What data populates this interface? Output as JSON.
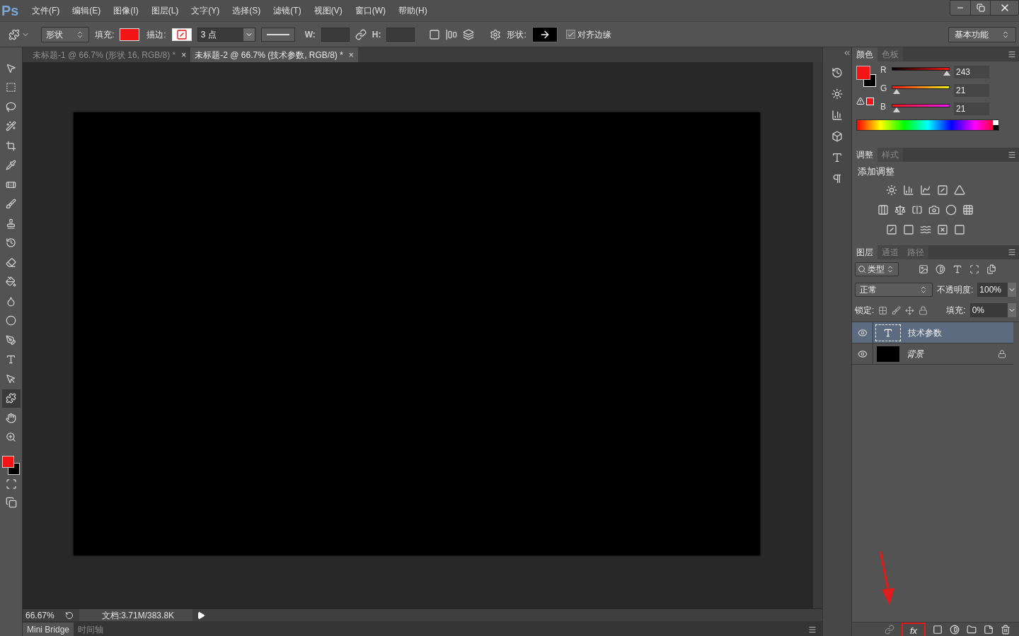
{
  "app_logo": "Ps",
  "menu": [
    "文件(F)",
    "编辑(E)",
    "图像(I)",
    "图层(L)",
    "文字(Y)",
    "选择(S)",
    "滤镜(T)",
    "视图(V)",
    "窗口(W)",
    "帮助(H)"
  ],
  "options_bar": {
    "mode": "形状",
    "fill_label": "填充:",
    "stroke_label": "描边:",
    "stroke_width": "3 点",
    "w_label": "W:",
    "h_label": "H:",
    "shape_label": "形状:",
    "align_edges": {
      "label": "对齐边缘",
      "checked": true
    },
    "workspace": "基本功能"
  },
  "doc_tabs": [
    {
      "title": "未标题-1 @ 66.7% (形状 16, RGB/8) *",
      "close": "×",
      "selected": false
    },
    {
      "title": "未标题-2 @ 66.7% (技术参数, RGB/8) *",
      "close": "×",
      "selected": true
    }
  ],
  "tools": [
    {
      "kind": "move",
      "selected": false
    },
    {
      "kind": "marquee",
      "selected": false
    },
    {
      "kind": "lasso",
      "selected": false
    },
    {
      "kind": "quick_select",
      "selected": false
    },
    {
      "kind": "crop",
      "selected": false
    },
    {
      "kind": "eyedropper",
      "selected": false
    },
    {
      "kind": "healing",
      "selected": false
    },
    {
      "kind": "brush",
      "selected": false
    },
    {
      "kind": "stamp",
      "selected": false
    },
    {
      "kind": "history_brush",
      "selected": false
    },
    {
      "kind": "eraser",
      "selected": false
    },
    {
      "kind": "bucket",
      "selected": false
    },
    {
      "kind": "blur",
      "selected": false
    },
    {
      "kind": "dodge",
      "selected": false
    },
    {
      "kind": "pen",
      "selected": false
    },
    {
      "kind": "type",
      "selected": false
    },
    {
      "kind": "path_select",
      "selected": false
    },
    {
      "kind": "custom_shape",
      "selected": true
    },
    {
      "kind": "hand",
      "selected": false
    },
    {
      "kind": "zoom",
      "selected": false
    }
  ],
  "color_panel": {
    "tabs": [
      {
        "label": "颜色",
        "selected": true
      },
      {
        "label": "色板",
        "selected": false
      }
    ],
    "channels": [
      {
        "name": "R",
        "value": "243",
        "level": 0.953
      },
      {
        "name": "G",
        "value": "21",
        "level": 0.082
      },
      {
        "name": "B",
        "value": "21",
        "level": 0.082
      }
    ]
  },
  "adjustments_panel": {
    "tabs": [
      {
        "label": "调整",
        "selected": true
      },
      {
        "label": "样式",
        "selected": false
      }
    ],
    "title": "添加调整"
  },
  "layers_panel": {
    "tabs": [
      {
        "label": "图层",
        "selected": true
      },
      {
        "label": "通道",
        "selected": false
      },
      {
        "label": "路径",
        "selected": false
      }
    ],
    "filter": "类型",
    "blend_mode": "正常",
    "opacity_label": "不透明度:",
    "opacity": "100%",
    "lock_label": "锁定:",
    "fill_label": "填充:",
    "fill": "0%",
    "layers": [
      {
        "name": "技术参数",
        "kind": "text",
        "visible": true,
        "selected": true,
        "locked": false
      },
      {
        "name": "背景",
        "kind": "fill",
        "visible": true,
        "selected": false,
        "locked": true
      }
    ],
    "fx_button": "fx"
  },
  "status_bar": {
    "zoom": "66.67%",
    "doc_info": "文档:3.71M/383.8K"
  },
  "bottom_tabs": [
    {
      "label": "Mini Bridge",
      "selected": true
    },
    {
      "label": "时间轴",
      "selected": false
    }
  ]
}
